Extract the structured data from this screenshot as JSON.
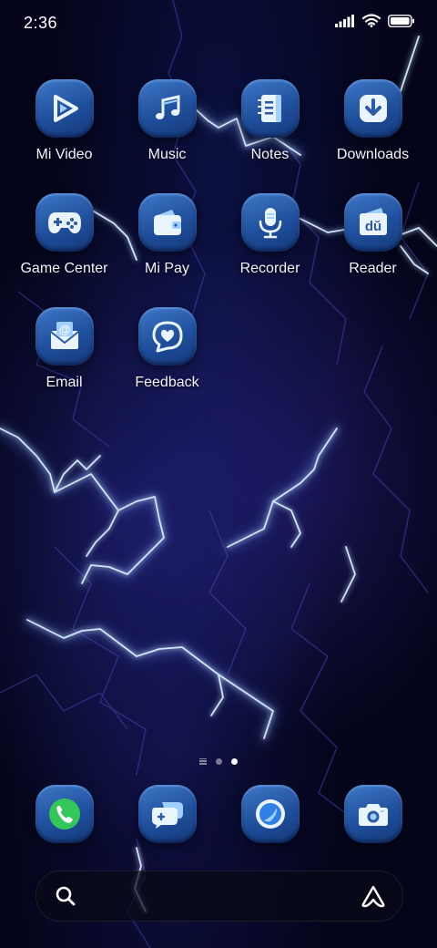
{
  "status_bar": {
    "time": "2:36",
    "icons": [
      "signal-icon",
      "wifi-icon",
      "battery-icon"
    ]
  },
  "apps": [
    {
      "label": "Mi Video",
      "icon": "play-icon"
    },
    {
      "label": "Music",
      "icon": "music-note-icon"
    },
    {
      "label": "Notes",
      "icon": "notepad-icon"
    },
    {
      "label": "Downloads",
      "icon": "download-arrow-icon"
    },
    {
      "label": "Game Center",
      "icon": "gamepad-icon"
    },
    {
      "label": "Mi Pay",
      "icon": "wallet-icon"
    },
    {
      "label": "Recorder",
      "icon": "microphone-icon"
    },
    {
      "label": "Reader",
      "icon": "reader-book-icon"
    },
    {
      "label": "Email",
      "icon": "envelope-at-icon"
    },
    {
      "label": "Feedback",
      "icon": "heart-bubble-icon"
    }
  ],
  "page_indicator": {
    "pages": 2,
    "current": 2
  },
  "dock": [
    {
      "app": "Phone",
      "icon": "phone-icon"
    },
    {
      "app": "Messages",
      "icon": "chat-bubbles-icon"
    },
    {
      "app": "Browser",
      "icon": "browser-circle-icon"
    },
    {
      "app": "Camera",
      "icon": "camera-icon"
    }
  ],
  "search_bar": {
    "icon": "search-icon",
    "assistant_icon": "assistant-icon"
  },
  "colors": {
    "icon_gradient_top": "#3f78c8",
    "icon_gradient_bottom": "#16397a",
    "phone_green": "#33c759",
    "wallpaper_base": "#04051a",
    "lightning": "#9fd4ff"
  }
}
